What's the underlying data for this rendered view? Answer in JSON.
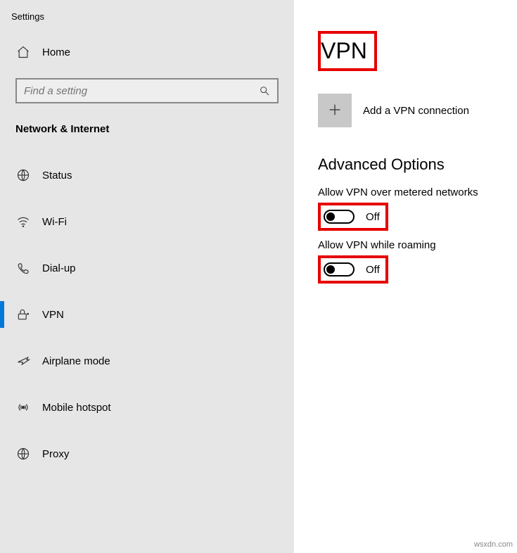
{
  "app_title": "Settings",
  "sidebar": {
    "home_label": "Home",
    "search_placeholder": "Find a setting",
    "category": "Network & Internet",
    "items": [
      {
        "label": "Status"
      },
      {
        "label": "Wi-Fi"
      },
      {
        "label": "Dial-up"
      },
      {
        "label": "VPN"
      },
      {
        "label": "Airplane mode"
      },
      {
        "label": "Mobile hotspot"
      },
      {
        "label": "Proxy"
      }
    ]
  },
  "main": {
    "title": "VPN",
    "add_label": "Add a VPN connection",
    "section_header": "Advanced Options",
    "options": [
      {
        "label": "Allow VPN over metered networks",
        "state": "Off"
      },
      {
        "label": "Allow VPN while roaming",
        "state": "Off"
      }
    ]
  },
  "watermark": "wsxdn.com"
}
